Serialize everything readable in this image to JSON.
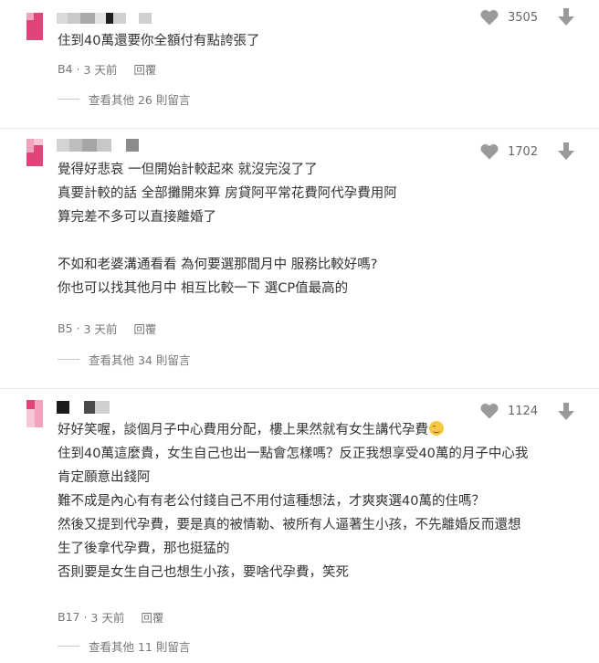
{
  "colors": {
    "accent_pink": "#e0457a",
    "light_pink": "#f2a2bd",
    "icon_gray": "#9a9a9a"
  },
  "comments": [
    {
      "likes": "3505",
      "text": "住到40萬還要你全額付有點誇張了",
      "floor": "B4",
      "time": "3 天前",
      "reply_label": "回覆",
      "more_replies": "查看其他 26 則留言",
      "like_icon": "heart-icon",
      "dislike_icon": "down-arrow-icon"
    },
    {
      "likes": "1702",
      "text": "覺得好悲哀 一但開始計較起來 就沒完沒了了\n真要計較的話 全部攤開來算 房貸阿平常花費阿代孕費用阿\n算完差不多可以直接離婚了\n\n不如和老婆溝通看看 為何要選那間月中 服務比較好嗎?\n你也可以找其他月中 相互比較一下 選CP值最高的",
      "floor": "B5",
      "time": "3 天前",
      "reply_label": "回覆",
      "more_replies": "查看其他 34 則留言",
      "like_icon": "heart-icon",
      "dislike_icon": "down-arrow-icon"
    },
    {
      "likes": "1124",
      "text_line1": "好好笑喔，談個月子中心費用分配，樓上果然就有女生講代孕費",
      "text_rest": "住到40萬這麼貴，女生自己也出一點會怎樣嗎？反正我想享受40萬的月子中心我\n肯定願意出錢阿\n難不成是內心有有老公付錢自己不用付這種想法，才爽爽選40萬的住嗎？\n然後又提到代孕費，要是真的被情勒、被所有人逼著生小孩，不先離婚反而還想\n生了後拿代孕費，那也挺猛的\n否則要是女生自己也想生小孩，要啥代孕費，笑死",
      "emoji": "grinning-face-icon",
      "floor": "B17",
      "time": "3 天前",
      "reply_label": "回覆",
      "more_replies": "查看其他 11 則留言",
      "like_icon": "heart-icon",
      "dislike_icon": "down-arrow-icon"
    }
  ]
}
